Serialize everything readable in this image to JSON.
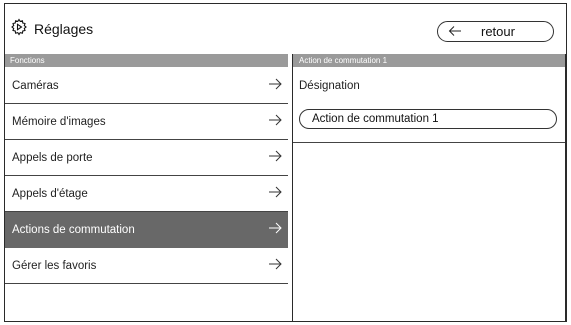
{
  "header": {
    "title": "Réglages",
    "back_label": "retour",
    "settings_icon": "gear-icon",
    "back_icon": "arrow-left-icon"
  },
  "left": {
    "section_label": "Fonctions",
    "items": [
      {
        "label": "Caméras",
        "active": false
      },
      {
        "label": "Mémoire d'images",
        "active": false
      },
      {
        "label": "Appels de porte",
        "active": false
      },
      {
        "label": "Appels d'étage",
        "active": false
      },
      {
        "label": "Actions de commutation",
        "active": true
      },
      {
        "label": "Gérer les favoris",
        "active": false
      }
    ],
    "chevron_icon": "arrow-right-icon"
  },
  "right": {
    "section_label": "Action de commutation 1",
    "field_label": "Désignation",
    "field_value": "Action de commutation 1"
  },
  "colors": {
    "header_bar": "#9a9a9a",
    "active_item": "#686868",
    "border": "#2a2a2a"
  }
}
